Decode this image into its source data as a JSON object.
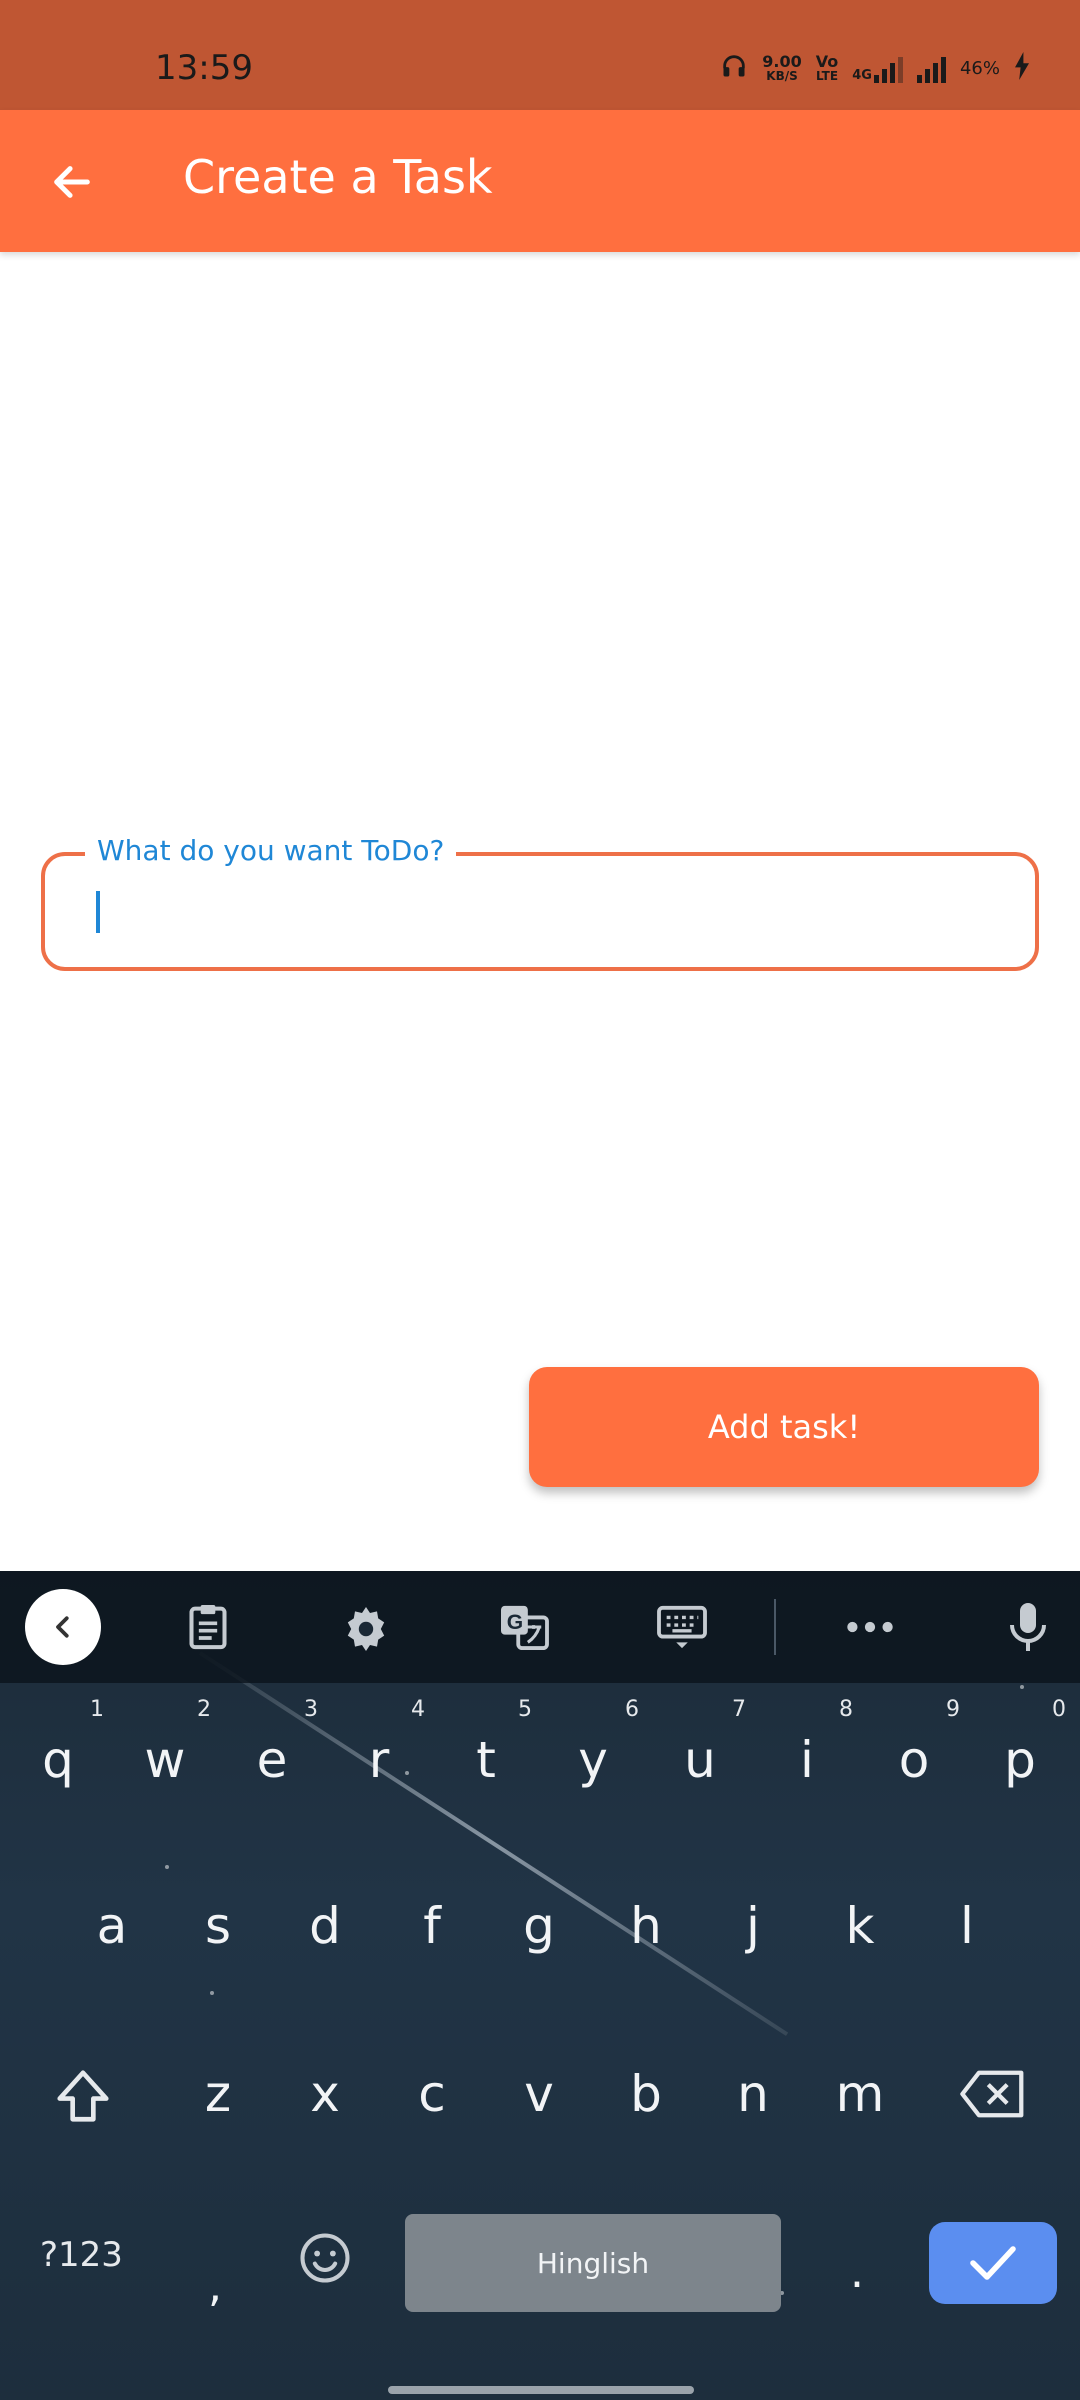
{
  "status_bar": {
    "time": "13:59",
    "speed_value": "9.00",
    "speed_unit": "KB/S",
    "volte_top": "Vo",
    "volte_bottom": "LTE",
    "network": "4G",
    "battery": "46%"
  },
  "app_bar": {
    "title": "Create a Task",
    "back_icon": "arrow-left-icon"
  },
  "form": {
    "label": "What do you want ToDo?",
    "value": "",
    "submit_label": "Add task!"
  },
  "colors": {
    "status_bar": "#bf5633",
    "app_bar": "#ff6f3f",
    "field_border": "#ee7048",
    "label": "#1f87d6",
    "button": "#ff6f3f"
  },
  "keyboard": {
    "toolbar": [
      "back-icon",
      "clipboard-icon",
      "settings-icon",
      "translate-icon",
      "keyboard-icon",
      "more-icon",
      "microphone-icon"
    ],
    "row1": [
      {
        "key": "q",
        "hint": "1"
      },
      {
        "key": "w",
        "hint": "2"
      },
      {
        "key": "e",
        "hint": "3"
      },
      {
        "key": "r",
        "hint": "4"
      },
      {
        "key": "t",
        "hint": "5"
      },
      {
        "key": "y",
        "hint": "6"
      },
      {
        "key": "u",
        "hint": "7"
      },
      {
        "key": "i",
        "hint": "8"
      },
      {
        "key": "o",
        "hint": "9"
      },
      {
        "key": "p",
        "hint": "0"
      }
    ],
    "row2": [
      "a",
      "s",
      "d",
      "f",
      "g",
      "h",
      "j",
      "k",
      "l"
    ],
    "row3": [
      "z",
      "x",
      "c",
      "v",
      "b",
      "n",
      "m"
    ],
    "symbols_label": "?123",
    "comma": ",",
    "space_label": "Hinglish",
    "period": "."
  }
}
